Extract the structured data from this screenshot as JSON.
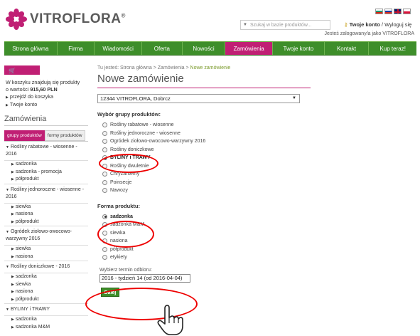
{
  "brand": {
    "name": "VITROFLORA",
    "reg": "®"
  },
  "search": {
    "placeholder": "Szukaj w bazie produktów..."
  },
  "account": {
    "your_account": "Twoje konto",
    "logout": "Wyloguj się",
    "logged_in_as": "Jesteś zalogowany/a jako VITROFLORA"
  },
  "nav": {
    "items": [
      {
        "label": "Strona główna"
      },
      {
        "label": "Firma"
      },
      {
        "label": "Wiadomości"
      },
      {
        "label": "Oferta"
      },
      {
        "label": "Nowości"
      },
      {
        "label": "Zamówienia"
      },
      {
        "label": "Twoje konto"
      },
      {
        "label": "Kontakt"
      },
      {
        "label": "Kup teraz!"
      }
    ],
    "active": "Zamówienia"
  },
  "cart": {
    "header": "Koszyk",
    "summary_line1": "W koszyku znajdują się produkty",
    "summary_prefix": "o wartości ",
    "summary_value": "915,60 PLN",
    "goto_cart": "przejdź do koszyka",
    "your_account": "Twoje konto"
  },
  "sidebar": {
    "title": "Zamówienia",
    "tabs": [
      "grupy produktów",
      "formy produktów"
    ],
    "groups": [
      {
        "label": "Rośliny rabatowe - wiosenne - 2016",
        "items": [
          "sadzonka",
          "sadzonka - promocja",
          "półprodukt"
        ]
      },
      {
        "label": "Rośliny jednoroczne - wiosenne - 2016",
        "items": [
          "siewka",
          "nasiona",
          "półprodukt"
        ]
      },
      {
        "label": "Ogródek ziołowo-owocowo-warzywny 2016",
        "items": [
          "siewka",
          "nasiona"
        ]
      },
      {
        "label": "Rośliny doniczkowe - 2016",
        "items": [
          "sadzonka",
          "siewka",
          "nasiona",
          "półprodukt"
        ]
      },
      {
        "label": "BYLINY i TRAWY",
        "items": [
          "sadzonka",
          "sadzonka M&M"
        ]
      }
    ]
  },
  "main": {
    "breadcrumb_prefix": "Tu jesteś: ",
    "breadcrumb_home": "Strona główna",
    "breadcrumb_sep1": " > ",
    "breadcrumb_orders": "Zamówienia",
    "breadcrumb_sep2": " > ",
    "breadcrumb_current": "Nowe zamówienie",
    "title": "Nowe zamówienie",
    "client": "12344 VITROFLORA, Dobrcz",
    "group_label": "Wybór grupy produktów:",
    "groups": [
      {
        "label": "Rośliny rabatowe - wiosenne",
        "checked": false
      },
      {
        "label": "Rośliny jednoroczne - wiosenne",
        "checked": false
      },
      {
        "label": "Ogródek ziołowo-owocowo-warzywny 2016",
        "checked": false
      },
      {
        "label": "Rośliny doniczkowe",
        "checked": false
      },
      {
        "label": "BYLINY i TRAWY",
        "checked": true
      },
      {
        "label": "Rośliny dwuletnie",
        "checked": false
      },
      {
        "label": "Chryzantemy",
        "checked": false
      },
      {
        "label": "Poinsecje",
        "checked": false
      },
      {
        "label": "Nawozy",
        "checked": false
      }
    ],
    "form_label": "Forma produktu:",
    "forms": [
      {
        "label": "sadzonka",
        "checked": true
      },
      {
        "label": "sadzonka M&M",
        "checked": false
      },
      {
        "label": "siewka",
        "checked": false
      },
      {
        "label": "nasiona",
        "checked": false
      },
      {
        "label": "półprodukt",
        "checked": false
      },
      {
        "label": "etykiety",
        "checked": false
      }
    ],
    "date_label": "Wybierz termin odbioru:",
    "date_value": "2016 - tydzień 14 (od 2016-04-04)",
    "next_button": "Dalej"
  },
  "colors": {
    "green": "#3e8e2a",
    "magenta": "#c01f74",
    "highlight": "#e00000"
  }
}
